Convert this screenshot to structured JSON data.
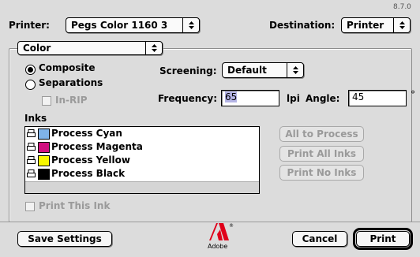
{
  "version": "8.7.0",
  "printer": {
    "label": "Printer:",
    "value": "Pegs Color 1160 3"
  },
  "destination": {
    "label": "Destination:",
    "value": "Printer"
  },
  "panel_popup": {
    "value": "Color"
  },
  "output_mode": {
    "composite": "Composite",
    "separations": "Separations",
    "selected": "Composite",
    "in_rip": "In-RIP"
  },
  "screening": {
    "label": "Screening:",
    "value": "Default"
  },
  "frequency": {
    "label": "Frequency:",
    "value": "65",
    "unit": "lpi"
  },
  "angle": {
    "label": "Angle:",
    "value": "45",
    "unit": "°"
  },
  "inks": {
    "label": "Inks",
    "items": [
      {
        "name": "Process Cyan",
        "color": "#7fb3e8"
      },
      {
        "name": "Process Magenta",
        "color": "#d0107f"
      },
      {
        "name": "Process Yellow",
        "color": "#f7f700"
      },
      {
        "name": "Process Black",
        "color": "#000000"
      }
    ]
  },
  "ink_buttons": {
    "all_to_process": "All to Process",
    "print_all": "Print All Inks",
    "print_none": "Print No Inks"
  },
  "print_this_ink": "Print This Ink",
  "footer": {
    "save_settings": "Save Settings",
    "cancel": "Cancel",
    "print": "Print",
    "adobe_label": "Adobe"
  }
}
